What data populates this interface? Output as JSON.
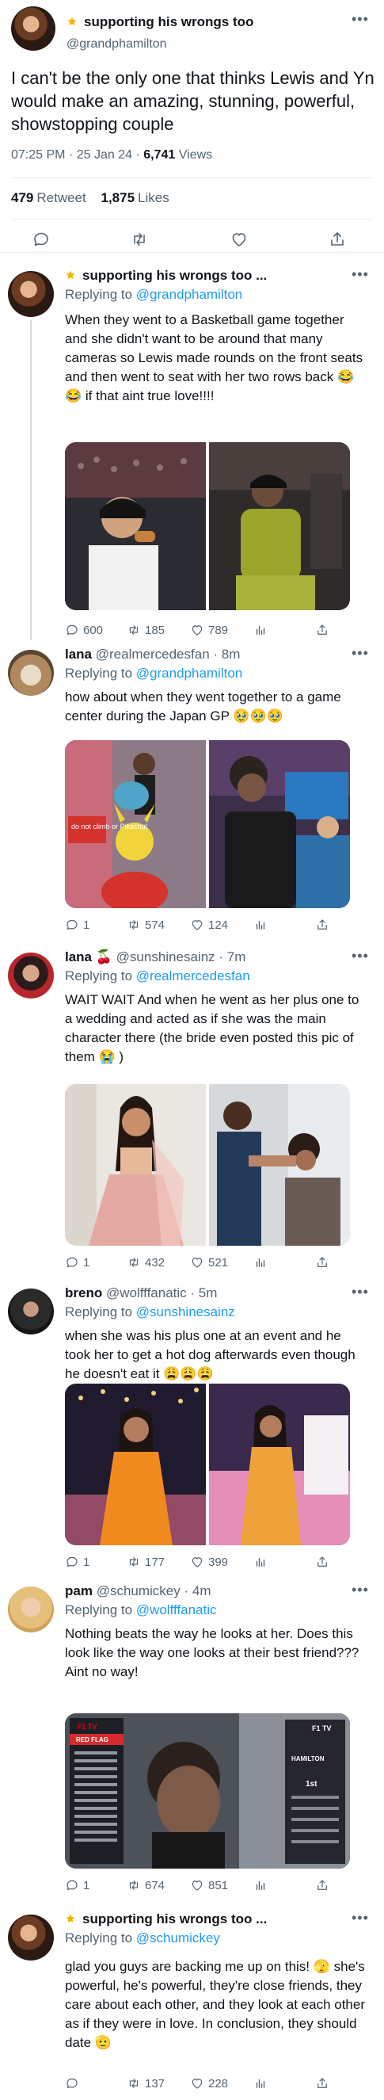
{
  "main_tweet": {
    "display_name": "supporting his wrongs too",
    "handle": "@grandphamilton",
    "text": "I can't be the only one that thinks Lewis and Yn would make an amazing, stunning, powerful, showstopping couple",
    "time": "07:25 PM",
    "date": "25 Jan 24",
    "separator": "·",
    "views_count": "6,741",
    "views_label": "Views",
    "retweets_count": "479",
    "retweets_label": "Retweet",
    "likes_count": "1,875",
    "likes_label": "Likes",
    "more": "•••"
  },
  "replies": [
    {
      "display_name": "supporting his wrongs too ...",
      "handle": "",
      "replying_label": "Replying to",
      "replying_to": "@grandphamilton",
      "text": "When they went to a Basketball game together and she didn't want to be around that many cameras so Lewis made rounds on the front seats and then went to seat with her two rows back 😂😂 if that aint true love!!!!",
      "comments": "600",
      "retweets": "185",
      "likes": "789",
      "more": "•••"
    },
    {
      "display_name": "lana",
      "handle": "@realmercedesfan · 8m",
      "replying_label": "Replying to",
      "replying_to": "@grandphamilton",
      "text": "how about when they went together to a game center during the Japan GP 🥹🥹🥹",
      "comments": "1",
      "retweets": "574",
      "likes": "124",
      "more": "•••",
      "image_sign": "do not climb or Pikachu!"
    },
    {
      "display_name": "lana 🍒",
      "handle": "@sunshinesainz · 7m",
      "replying_label": "Replying to",
      "replying_to": "@realmercedesfan",
      "text": "WAIT WAIT And when he went as her plus one to a wedding and acted as if she was the main character there (the bride even posted this pic of them 😭 )",
      "comments": "1",
      "retweets": "432",
      "likes": "521",
      "more": "•••"
    },
    {
      "display_name": "breno",
      "handle": "@wolfffanatic · 5m",
      "replying_label": "Replying to",
      "replying_to": "@sunshinesainz",
      "text": "when she was his plus one at an event and he took her to get a hot dog afterwards even though he doesn't eat it 😩😩😩",
      "comments": "1",
      "retweets": "177",
      "likes": "399",
      "more": "•••"
    },
    {
      "display_name": "pam",
      "handle": "@schumickey · 4m",
      "replying_label": "Replying to",
      "replying_to": "@wolfffanatic",
      "text": "Nothing beats the way he looks at her. Does this look like the way one looks at their best friend??? Aint no way!",
      "comments": "1",
      "retweets": "674",
      "likes": "851",
      "more": "•••",
      "image_f1": "F1 TV",
      "image_flag": "RED FLAG",
      "image_name": "HAMILTON",
      "image_pos": "1st"
    },
    {
      "display_name": "supporting his wrongs too ...",
      "handle": "",
      "replying_label": "Replying to",
      "replying_to": "@schumickey",
      "text": "glad you guys are backing me up on this! 🫣 she's powerful, he's powerful, they're close friends, they care about each other, and they look at each other as if they were in love. In conclusion, they should date 🫡",
      "comments": "",
      "retweets": "137",
      "likes": "228",
      "more": "•••"
    }
  ],
  "icons": {
    "reply": "comment-icon",
    "retweet": "retweet-icon",
    "like": "heart-icon",
    "analytics": "analytics-icon",
    "share": "share-icon",
    "verified": "star-icon"
  },
  "colors": {
    "link": "#1d9bf0",
    "muted": "#536471",
    "text": "#0f1419",
    "star": "#f5b400"
  }
}
